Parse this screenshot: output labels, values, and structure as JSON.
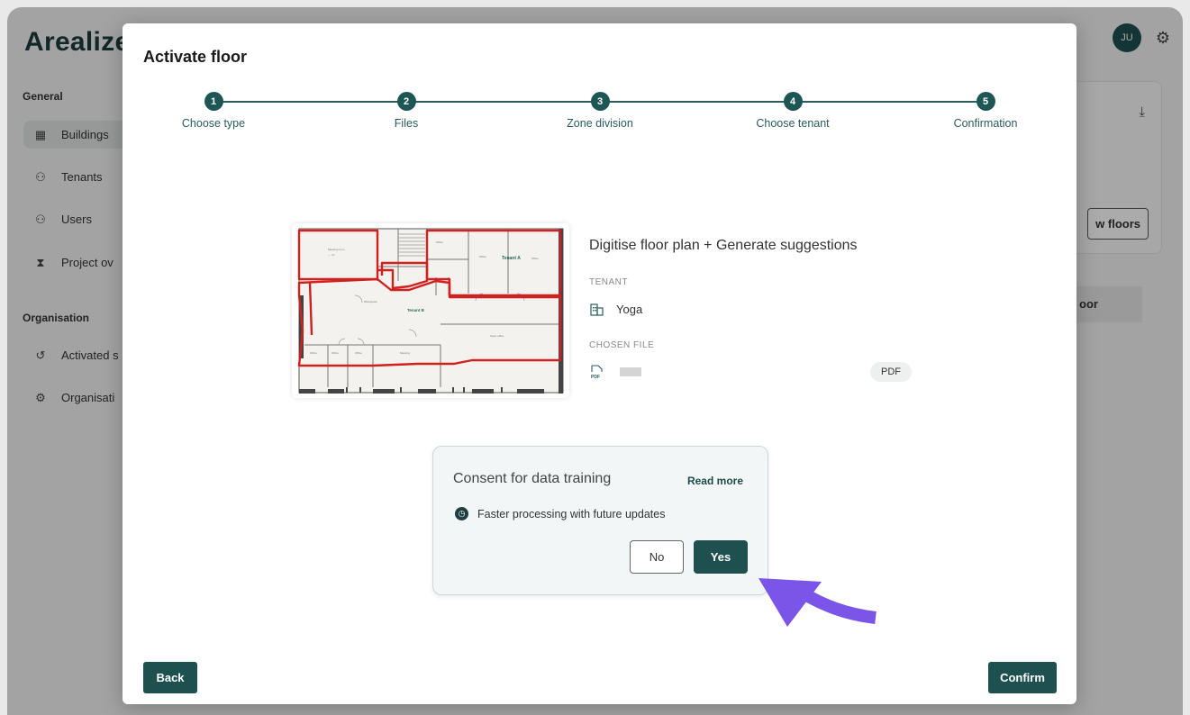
{
  "app": {
    "logo": "Arealize",
    "avatar_initials": "JU",
    "sidebar": {
      "sections": [
        {
          "label": "General"
        },
        {
          "label": "Organisation"
        }
      ],
      "items": [
        {
          "label": "Buildings",
          "icon": "building-icon"
        },
        {
          "label": "Tenants",
          "icon": "users-icon"
        },
        {
          "label": "Users",
          "icon": "users-icon"
        },
        {
          "label": "Project ov",
          "icon": "hourglass-icon"
        },
        {
          "label": "Activated s",
          "icon": "history-icon"
        },
        {
          "label": "Organisati",
          "icon": "gear-icon"
        }
      ]
    },
    "background": {
      "view_floors_label": "w floors",
      "row_label": "oor"
    }
  },
  "modal": {
    "title": "Activate floor",
    "steps": [
      {
        "number": "1",
        "label": "Choose type"
      },
      {
        "number": "2",
        "label": "Files"
      },
      {
        "number": "3",
        "label": "Zone division"
      },
      {
        "number": "4",
        "label": "Choose tenant"
      },
      {
        "number": "5",
        "label": "Confirmation"
      }
    ],
    "summary": {
      "title": "Digitise floor plan + Generate suggestions",
      "tenant_label": "TENANT",
      "tenant_value": "Yoga",
      "file_label": "CHOSEN FILE",
      "file_badge": "PDF"
    },
    "floorplan_labels": {
      "tenant_a": "Tenant A",
      "tenant_b": "Tenant B"
    },
    "consent": {
      "title": "Consent for data training",
      "read_more": "Read more",
      "feature": "Faster processing with future updates",
      "no_label": "No",
      "yes_label": "Yes"
    },
    "back_label": "Back",
    "confirm_label": "Confirm"
  },
  "colors": {
    "brand": "#1e5050",
    "zone_outline": "#d02020",
    "pointer": "#7b55e8"
  }
}
